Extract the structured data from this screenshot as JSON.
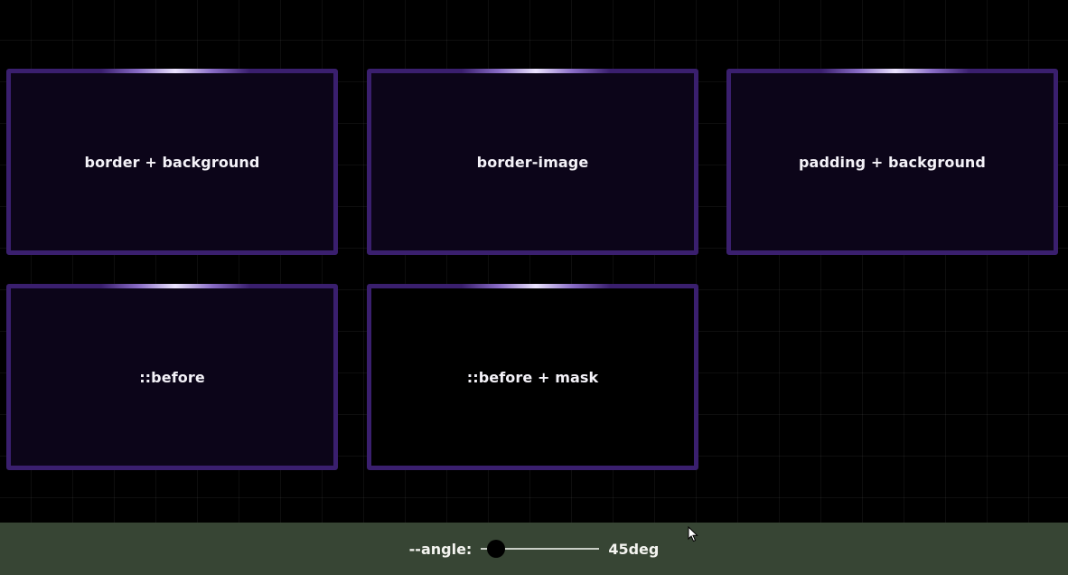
{
  "cards": [
    {
      "label": "border + background"
    },
    {
      "label": "border-image"
    },
    {
      "label": "padding + background"
    },
    {
      "label": "::before"
    },
    {
      "label": "::before + mask"
    }
  ],
  "control": {
    "label": "--angle:",
    "value": 45,
    "display_value": "45deg",
    "min": 0,
    "max": 360
  },
  "colors": {
    "card_border": "#3a1f6e",
    "card_fill": "#0c0519",
    "bottom_bar": "#374534"
  },
  "icons": {
    "cursor": "mouse-pointer-icon"
  }
}
